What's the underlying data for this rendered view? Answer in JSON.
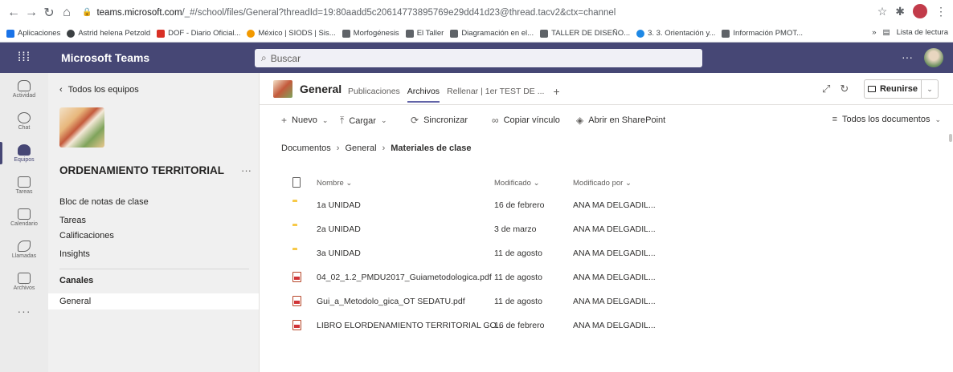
{
  "browser": {
    "url_host": "teams.microsoft.com",
    "url_path": "/_#/school/files/General?threadId=19:80aadd5c20614773895769e29dd41d23@thread.tacv2&ctx=channel",
    "bookmarks": [
      {
        "label": "Aplicaciones",
        "color": "#1a73e8"
      },
      {
        "label": "Astrid helena Petzold",
        "color": "#3c4043"
      },
      {
        "label": "DOF - Diario Oficial...",
        "color": "#d93025"
      },
      {
        "label": "México | SIODS | Sis...",
        "color": "#f29900"
      },
      {
        "label": "Morfogénesis",
        "color": "#5f6368"
      },
      {
        "label": "El Taller",
        "color": "#5f6368"
      },
      {
        "label": "Diagramación en el...",
        "color": "#5f6368"
      },
      {
        "label": "TALLER DE DISEÑO...",
        "color": "#5f6368"
      },
      {
        "label": "3. 3. Orientación y...",
        "color": "#1e88e5"
      },
      {
        "label": "Información PMOT...",
        "color": "#5f6368"
      }
    ],
    "overflow": "»",
    "reading_list": "Lista de lectura"
  },
  "teams": {
    "app_name": "Microsoft Teams",
    "search_placeholder": "Buscar",
    "more": "···"
  },
  "rail": [
    {
      "label": "Actividad",
      "icon": "bell-icon",
      "shape": "bell",
      "active": false
    },
    {
      "label": "Chat",
      "icon": "chat-icon",
      "shape": "chat",
      "active": false
    },
    {
      "label": "Equipos",
      "icon": "teams-icon",
      "shape": "people",
      "active": true
    },
    {
      "label": "Tareas",
      "icon": "assignments-icon",
      "shape": "",
      "active": false
    },
    {
      "label": "Calendario",
      "icon": "calendar-icon",
      "shape": "",
      "active": false
    },
    {
      "label": "Llamadas",
      "icon": "phone-icon",
      "shape": "phone",
      "active": false
    },
    {
      "label": "Archivos",
      "icon": "files-icon",
      "shape": "",
      "active": false
    }
  ],
  "rail_more": "···",
  "team": {
    "back": "Todos los equipos",
    "name": "ORDENAMIENTO TERRITORIAL",
    "more": "···",
    "links": [
      "Bloc de notas de clase",
      "Tareas",
      "Calificaciones",
      "Insights"
    ],
    "channels_heading": "Canales",
    "channel": "General"
  },
  "channel": {
    "title": "General",
    "tabs": [
      "Publicaciones",
      "Archivos",
      "Rellenar | 1er TEST DE ..."
    ],
    "active_tab": "Archivos",
    "add_tab": "+",
    "meet_label": "Reunirse"
  },
  "commands": {
    "new": "Nuevo",
    "upload": "Cargar",
    "sync": "Sincronizar",
    "copy_link": "Copiar vínculo",
    "sharepoint": "Abrir en SharePoint",
    "view": "Todos los documentos"
  },
  "breadcrumb": [
    "Documentos",
    "General",
    "Materiales de clase"
  ],
  "table": {
    "headers": {
      "name": "Nombre",
      "modified": "Modificado",
      "modified_by": "Modificado por"
    },
    "rows": [
      {
        "type": "folder",
        "name": "1a UNIDAD",
        "modified": "16 de febrero",
        "by": "ANA MA DELGADIL..."
      },
      {
        "type": "folder",
        "name": "2a UNIDAD",
        "modified": "3 de marzo",
        "by": "ANA MA DELGADIL..."
      },
      {
        "type": "folder",
        "name": "3a UNIDAD",
        "modified": "11 de agosto",
        "by": "ANA MA DELGADIL..."
      },
      {
        "type": "pdf",
        "name": "04_02_1.2_PMDU2017_Guiametodologica.pdf",
        "modified": "11 de agosto",
        "by": "ANA MA DELGADIL..."
      },
      {
        "type": "pdf",
        "name": "Gui_a_Metodolo_gica_OT SEDATU.pdf",
        "modified": "11 de agosto",
        "by": "ANA MA DELGADIL..."
      },
      {
        "type": "pdf",
        "name": "LIBRO ELORDENAMIENTO TERRITORIAL GO...",
        "modified": "16 de febrero",
        "by": "ANA MA DELGADIL..."
      }
    ]
  },
  "colors": {
    "teams_purple": "#464775",
    "accent": "#6264a7",
    "folder": "#f7c948",
    "pdf": "#d13438"
  }
}
